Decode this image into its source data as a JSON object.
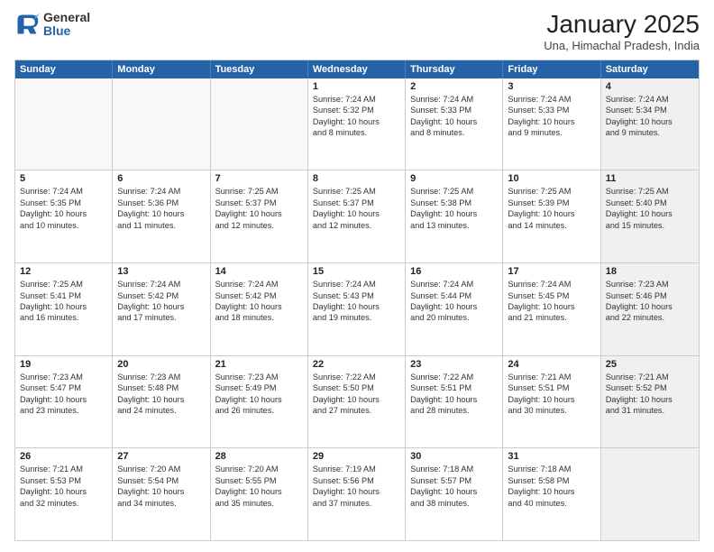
{
  "logo": {
    "general": "General",
    "blue": "Blue"
  },
  "title": "January 2025",
  "subtitle": "Una, Himachal Pradesh, India",
  "days": [
    "Sunday",
    "Monday",
    "Tuesday",
    "Wednesday",
    "Thursday",
    "Friday",
    "Saturday"
  ],
  "rows": [
    [
      {
        "day": "",
        "lines": [],
        "empty": true
      },
      {
        "day": "",
        "lines": [],
        "empty": true
      },
      {
        "day": "",
        "lines": [],
        "empty": true
      },
      {
        "day": "1",
        "lines": [
          "Sunrise: 7:24 AM",
          "Sunset: 5:32 PM",
          "Daylight: 10 hours",
          "and 8 minutes."
        ],
        "empty": false
      },
      {
        "day": "2",
        "lines": [
          "Sunrise: 7:24 AM",
          "Sunset: 5:33 PM",
          "Daylight: 10 hours",
          "and 8 minutes."
        ],
        "empty": false
      },
      {
        "day": "3",
        "lines": [
          "Sunrise: 7:24 AM",
          "Sunset: 5:33 PM",
          "Daylight: 10 hours",
          "and 9 minutes."
        ],
        "empty": false
      },
      {
        "day": "4",
        "lines": [
          "Sunrise: 7:24 AM",
          "Sunset: 5:34 PM",
          "Daylight: 10 hours",
          "and 9 minutes."
        ],
        "empty": false,
        "shaded": true
      }
    ],
    [
      {
        "day": "5",
        "lines": [
          "Sunrise: 7:24 AM",
          "Sunset: 5:35 PM",
          "Daylight: 10 hours",
          "and 10 minutes."
        ],
        "empty": false
      },
      {
        "day": "6",
        "lines": [
          "Sunrise: 7:24 AM",
          "Sunset: 5:36 PM",
          "Daylight: 10 hours",
          "and 11 minutes."
        ],
        "empty": false
      },
      {
        "day": "7",
        "lines": [
          "Sunrise: 7:25 AM",
          "Sunset: 5:37 PM",
          "Daylight: 10 hours",
          "and 12 minutes."
        ],
        "empty": false
      },
      {
        "day": "8",
        "lines": [
          "Sunrise: 7:25 AM",
          "Sunset: 5:37 PM",
          "Daylight: 10 hours",
          "and 12 minutes."
        ],
        "empty": false
      },
      {
        "day": "9",
        "lines": [
          "Sunrise: 7:25 AM",
          "Sunset: 5:38 PM",
          "Daylight: 10 hours",
          "and 13 minutes."
        ],
        "empty": false
      },
      {
        "day": "10",
        "lines": [
          "Sunrise: 7:25 AM",
          "Sunset: 5:39 PM",
          "Daylight: 10 hours",
          "and 14 minutes."
        ],
        "empty": false
      },
      {
        "day": "11",
        "lines": [
          "Sunrise: 7:25 AM",
          "Sunset: 5:40 PM",
          "Daylight: 10 hours",
          "and 15 minutes."
        ],
        "empty": false,
        "shaded": true
      }
    ],
    [
      {
        "day": "12",
        "lines": [
          "Sunrise: 7:25 AM",
          "Sunset: 5:41 PM",
          "Daylight: 10 hours",
          "and 16 minutes."
        ],
        "empty": false
      },
      {
        "day": "13",
        "lines": [
          "Sunrise: 7:24 AM",
          "Sunset: 5:42 PM",
          "Daylight: 10 hours",
          "and 17 minutes."
        ],
        "empty": false
      },
      {
        "day": "14",
        "lines": [
          "Sunrise: 7:24 AM",
          "Sunset: 5:42 PM",
          "Daylight: 10 hours",
          "and 18 minutes."
        ],
        "empty": false
      },
      {
        "day": "15",
        "lines": [
          "Sunrise: 7:24 AM",
          "Sunset: 5:43 PM",
          "Daylight: 10 hours",
          "and 19 minutes."
        ],
        "empty": false
      },
      {
        "day": "16",
        "lines": [
          "Sunrise: 7:24 AM",
          "Sunset: 5:44 PM",
          "Daylight: 10 hours",
          "and 20 minutes."
        ],
        "empty": false
      },
      {
        "day": "17",
        "lines": [
          "Sunrise: 7:24 AM",
          "Sunset: 5:45 PM",
          "Daylight: 10 hours",
          "and 21 minutes."
        ],
        "empty": false
      },
      {
        "day": "18",
        "lines": [
          "Sunrise: 7:23 AM",
          "Sunset: 5:46 PM",
          "Daylight: 10 hours",
          "and 22 minutes."
        ],
        "empty": false,
        "shaded": true
      }
    ],
    [
      {
        "day": "19",
        "lines": [
          "Sunrise: 7:23 AM",
          "Sunset: 5:47 PM",
          "Daylight: 10 hours",
          "and 23 minutes."
        ],
        "empty": false
      },
      {
        "day": "20",
        "lines": [
          "Sunrise: 7:23 AM",
          "Sunset: 5:48 PM",
          "Daylight: 10 hours",
          "and 24 minutes."
        ],
        "empty": false
      },
      {
        "day": "21",
        "lines": [
          "Sunrise: 7:23 AM",
          "Sunset: 5:49 PM",
          "Daylight: 10 hours",
          "and 26 minutes."
        ],
        "empty": false
      },
      {
        "day": "22",
        "lines": [
          "Sunrise: 7:22 AM",
          "Sunset: 5:50 PM",
          "Daylight: 10 hours",
          "and 27 minutes."
        ],
        "empty": false
      },
      {
        "day": "23",
        "lines": [
          "Sunrise: 7:22 AM",
          "Sunset: 5:51 PM",
          "Daylight: 10 hours",
          "and 28 minutes."
        ],
        "empty": false
      },
      {
        "day": "24",
        "lines": [
          "Sunrise: 7:21 AM",
          "Sunset: 5:51 PM",
          "Daylight: 10 hours",
          "and 30 minutes."
        ],
        "empty": false
      },
      {
        "day": "25",
        "lines": [
          "Sunrise: 7:21 AM",
          "Sunset: 5:52 PM",
          "Daylight: 10 hours",
          "and 31 minutes."
        ],
        "empty": false,
        "shaded": true
      }
    ],
    [
      {
        "day": "26",
        "lines": [
          "Sunrise: 7:21 AM",
          "Sunset: 5:53 PM",
          "Daylight: 10 hours",
          "and 32 minutes."
        ],
        "empty": false
      },
      {
        "day": "27",
        "lines": [
          "Sunrise: 7:20 AM",
          "Sunset: 5:54 PM",
          "Daylight: 10 hours",
          "and 34 minutes."
        ],
        "empty": false
      },
      {
        "day": "28",
        "lines": [
          "Sunrise: 7:20 AM",
          "Sunset: 5:55 PM",
          "Daylight: 10 hours",
          "and 35 minutes."
        ],
        "empty": false
      },
      {
        "day": "29",
        "lines": [
          "Sunrise: 7:19 AM",
          "Sunset: 5:56 PM",
          "Daylight: 10 hours",
          "and 37 minutes."
        ],
        "empty": false
      },
      {
        "day": "30",
        "lines": [
          "Sunrise: 7:18 AM",
          "Sunset: 5:57 PM",
          "Daylight: 10 hours",
          "and 38 minutes."
        ],
        "empty": false
      },
      {
        "day": "31",
        "lines": [
          "Sunrise: 7:18 AM",
          "Sunset: 5:58 PM",
          "Daylight: 10 hours",
          "and 40 minutes."
        ],
        "empty": false
      },
      {
        "day": "",
        "lines": [],
        "empty": true,
        "shaded": true
      }
    ]
  ]
}
